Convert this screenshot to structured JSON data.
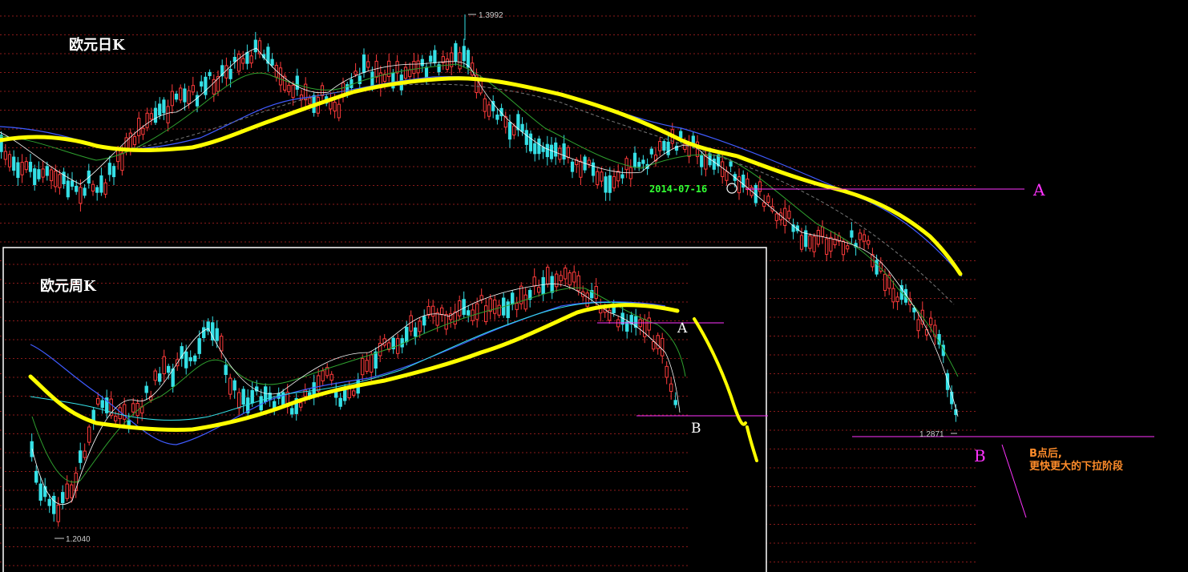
{
  "chart_data": [
    {
      "type": "candlestick",
      "title": "欧元日K",
      "high_label": "1.3992",
      "low_label": "1.2871",
      "date_label": "2014-07-16",
      "point_labels": {
        "a": "A",
        "b": "B"
      },
      "annotation": {
        "line1": "B点后,",
        "line2": "更快更大的下拉阶段"
      },
      "colors": {
        "up": "#ff3b3b",
        "down": "#35e0e6",
        "ma_thick": "#ffff00",
        "ma_blue": "#3f5bff",
        "ma_green": "#2fa12f",
        "ma_white": "#ffffff",
        "magenta": "#ff33ff",
        "grid": "#8a1a1a"
      }
    },
    {
      "type": "candlestick",
      "title": "欧元周K",
      "low_label": "1.2040",
      "point_labels": {
        "a": "A",
        "b": "B"
      }
    }
  ]
}
